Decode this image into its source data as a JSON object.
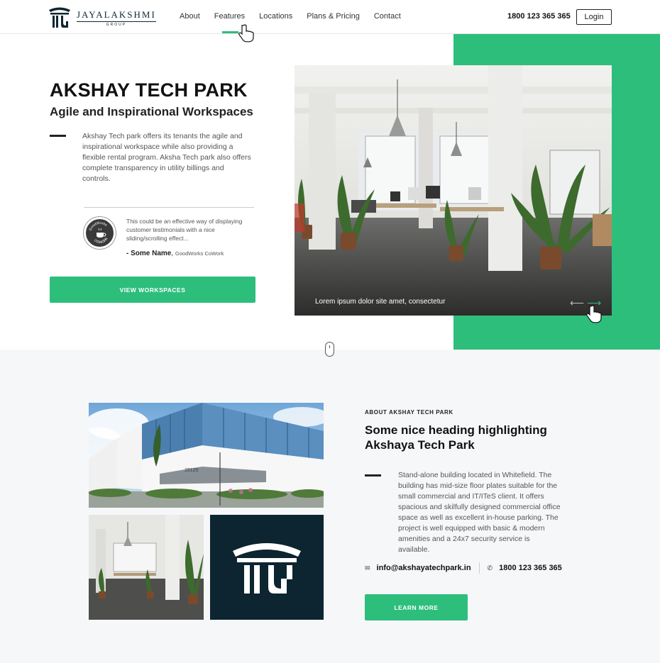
{
  "brand": {
    "name": "JAYALAKSHMI",
    "sub": "GROUP"
  },
  "nav": {
    "items": [
      "About",
      "Features",
      "Locations",
      "Plans & Pricing",
      "Contact"
    ],
    "active": "Features"
  },
  "header": {
    "phone": "1800 123 365 365",
    "login_label": "Login"
  },
  "hero": {
    "title": "AKSHAY TECH PARK",
    "subtitle": "Agile and Inspirational Workspaces",
    "description": "Akshay Tech park offers its tenants the agile and inspirational workspace while also providing a flexible rental program. Aksha Tech park also offers complete transparency in utility billings and controls.",
    "testimonial": {
      "text": "This could be an effective way of displaying customer testimonials with a nice sliding/scrolling effect...",
      "author": "- Some Name",
      "company": "GoodWorks CoWork",
      "avatar_label_top": "GoodWorks",
      "avatar_label_bottom": "COWORK"
    },
    "cta_label": "VIEW WORKSPACES",
    "slide_caption": "Lorem ipsum dolor site amet, consectetur",
    "arrow_prev": "⟵",
    "arrow_next": "⟶"
  },
  "about": {
    "kicker": "ABOUT AKSHAY TECH PARK",
    "heading": "Some nice heading highlighting Akshaya Tech Park",
    "description": "Stand-alone building located in Whitefield. The building has mid-size floor plates suitable for the small commercial and IT/ITeS client. It offers spacious and skilfully designed commercial office space as well as excellent in-house parking. The project is well equipped with basic & modern amenities and a 24x7 security service is available.",
    "email": "info@akshayatechpark.in",
    "phone": "1800 123 365 365",
    "cta_label": "LEARN MORE",
    "building_number": "15120"
  },
  "colors": {
    "accent": "#2dbe7c",
    "dark": "#0c2530",
    "section_bg": "#f6f7f8"
  },
  "icons": {
    "email": "envelope-icon",
    "phone": "phone-icon",
    "scroll": "mouse-icon"
  }
}
